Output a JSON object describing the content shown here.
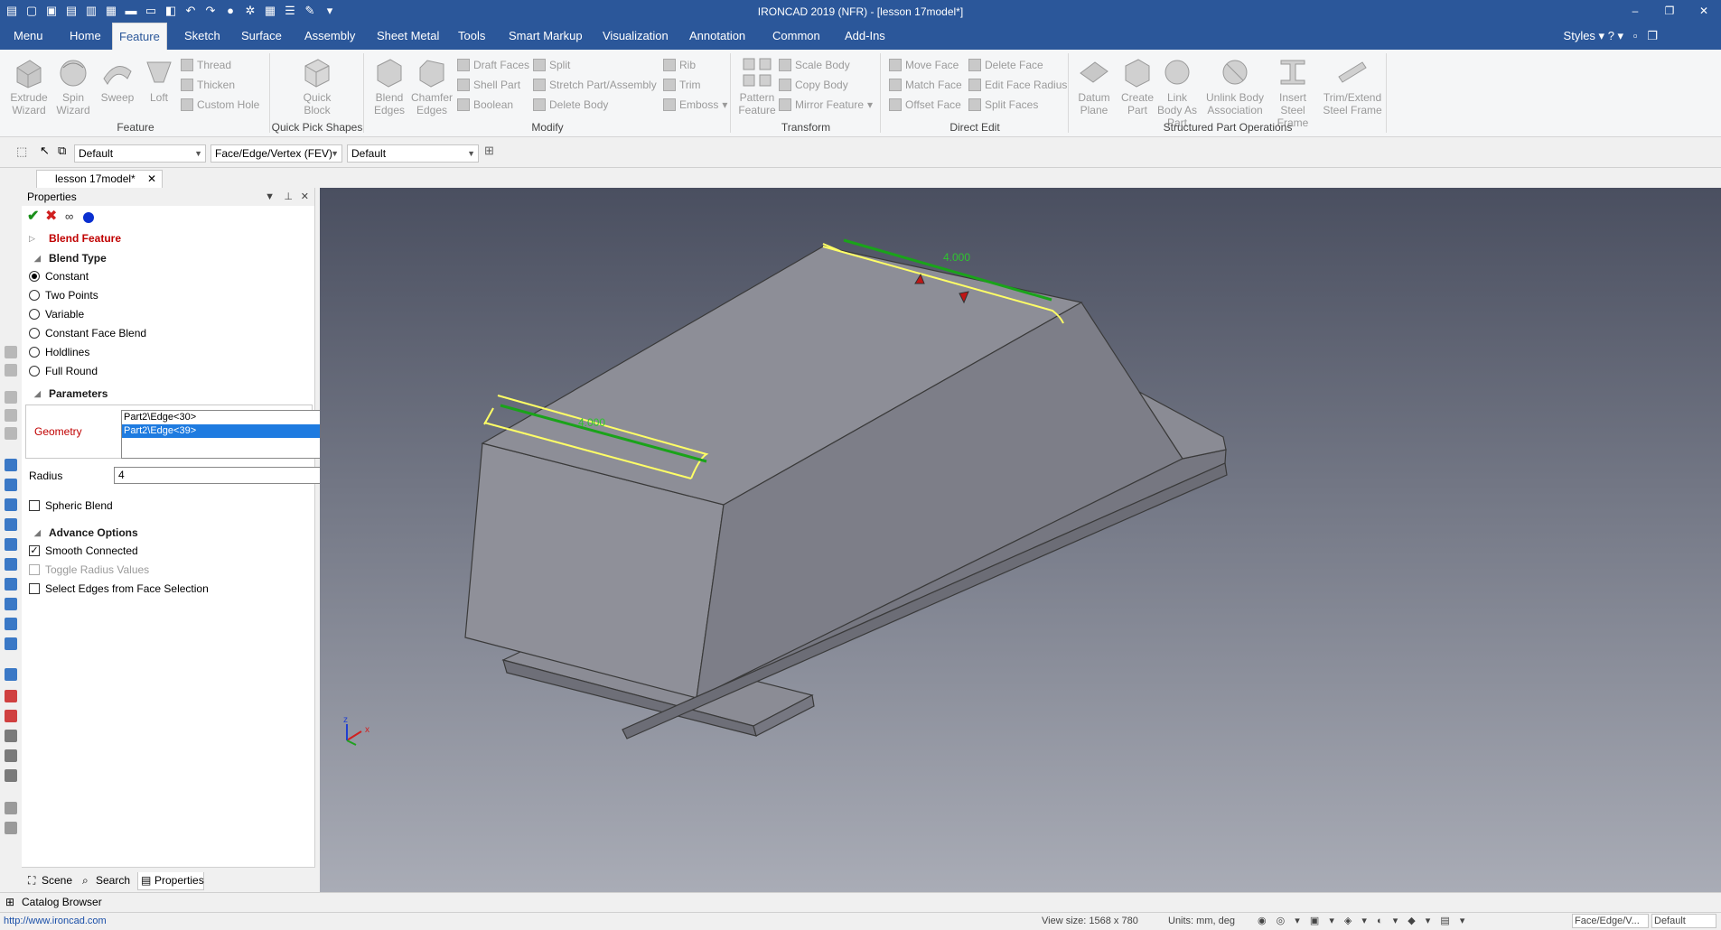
{
  "app": {
    "title": "IRONCAD 2019 (NFR) - [lesson 17model*]"
  },
  "window_controls": {
    "minimize": "–",
    "restore": "❐",
    "close": "✕"
  },
  "menu_tabs": [
    "Menu",
    "Home",
    "Feature",
    "Sketch",
    "Surface",
    "Assembly",
    "Sheet Metal",
    "Tools",
    "Smart Markup",
    "Visualization",
    "Annotation",
    "Common",
    "Add-Ins"
  ],
  "active_tab": "Feature",
  "styles_menu": "Styles",
  "ribbon": {
    "feature_group": {
      "label": "Feature",
      "extrude": "Extrude Wizard",
      "spin": "Spin Wizard",
      "sweep": "Sweep",
      "loft": "Loft",
      "thread": "Thread",
      "thicken": "Thicken",
      "custom_hole": "Custom Hole"
    },
    "quick_pick": {
      "label": "Quick Pick Shapes",
      "quick_block": "Quick Block"
    },
    "modify": {
      "label": "Modify",
      "blend_edges": "Blend Edges",
      "chamfer_edges": "Chamfer Edges",
      "draft_faces": "Draft Faces",
      "shell_part": "Shell Part",
      "boolean": "Boolean",
      "split": "Split",
      "stretch": "Stretch Part/Assembly",
      "delete_body": "Delete Body",
      "rib": "Rib",
      "trim": "Trim",
      "emboss": "Emboss"
    },
    "transform": {
      "label": "Transform",
      "pattern_feature": "Pattern Feature",
      "scale_body": "Scale Body",
      "copy_body": "Copy Body",
      "mirror_feature": "Mirror Feature"
    },
    "direct_edit": {
      "label": "Direct Edit",
      "move_face": "Move Face",
      "match_face": "Match Face",
      "offset_face": "Offset Face",
      "delete_face": "Delete Face",
      "edit_face_radius": "Edit Face Radius",
      "split_faces": "Split Faces"
    },
    "structured": {
      "label": "Structured Part Operations",
      "datum_plane": "Datum Plane",
      "create_part": "Create Part",
      "link_body": "Link Body As Part",
      "unlink_body": "Unlink Body Association",
      "insert_steel": "Insert Steel Frame",
      "trim_extend": "Trim/Extend Steel Frame"
    }
  },
  "toolbar": {
    "combo1": "Default",
    "combo2": "Face/Edge/Vertex (FEV)",
    "combo3": "Default"
  },
  "document_tab": "lesson 17model*",
  "properties": {
    "title": "Properties",
    "feature_name": "Blend Feature",
    "blend_type_label": "Blend Type",
    "blend_types": [
      "Constant",
      "Two Points",
      "Variable",
      "Constant Face Blend",
      "Holdlines",
      "Full Round"
    ],
    "selected_blend_type": "Constant",
    "parameters_label": "Parameters",
    "geometry_label": "Geometry",
    "geometry_items": [
      "Part2\\Edge<30>",
      "Part2\\Edge<39>"
    ],
    "radius_label": "Radius",
    "radius_value": "4",
    "spheric_blend": "Spheric Blend",
    "advance_label": "Advance Options",
    "smooth_connected": "Smooth Connected",
    "toggle_radius": "Toggle Radius Values",
    "select_edges": "Select Edges from Face Selection",
    "tabs": [
      "Scene",
      "Search",
      "Properties"
    ]
  },
  "viewport": {
    "dim_top": "4.000",
    "dim_left": "4.000",
    "axis_x": "x",
    "axis_z": "z"
  },
  "catalog_browser": "Catalog Browser",
  "status": {
    "url": "http://www.ironcad.com",
    "view_size": "View size: 1568 x  780",
    "units": "Units: mm, deg",
    "mode": "Face/Edge/V...",
    "style": "Default"
  },
  "colors": {
    "title_bar": "#2b579a",
    "highlight_edge": "#ffff66",
    "selected_edge": "#1aa31a",
    "feature_red": "#c00000"
  }
}
